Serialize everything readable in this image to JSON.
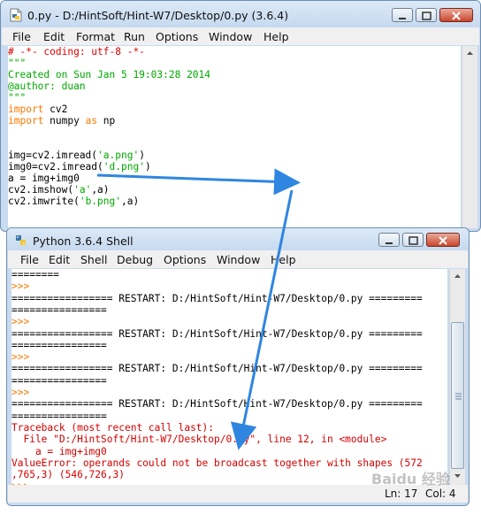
{
  "editor_window": {
    "title": "0.py - D:/HintSoft/Hint-W7/Desktop/0.py (3.6.4)",
    "menu": [
      "File",
      "Edit",
      "Format",
      "Run",
      "Options",
      "Window",
      "Help"
    ],
    "code_lines": [
      {
        "text": "# -*- coding: utf-8 -*-",
        "color": "red"
      },
      {
        "text": "\"\"\"",
        "color": "green"
      },
      {
        "text": "Created on Sun Jan 5 19:03:28 2014",
        "color": "green"
      },
      {
        "text": "@author: duan",
        "color": "green"
      },
      {
        "text": "\"\"\"",
        "color": "green"
      },
      {
        "text": "import",
        "color": "orange",
        "rest": " cv2"
      },
      {
        "text": "import",
        "color": "orange",
        "rest": " numpy ",
        "kw2": "as",
        "rest2": " np"
      },
      {
        "text": "",
        "color": "black"
      },
      {
        "text": "",
        "color": "black"
      },
      {
        "text": "img=cv2.imread(",
        "color": "black",
        "str": "'a.png'",
        "tail": ")"
      },
      {
        "text": "img0=cv2.imread(",
        "color": "black",
        "str": "'d.png'",
        "tail": ")"
      },
      {
        "text": "a = img+img0",
        "color": "black"
      },
      {
        "text": "cv2.imshow(",
        "color": "black",
        "str": "'a'",
        "tail": ",a)"
      },
      {
        "text": "cv2.imwrite(",
        "color": "black",
        "str": "'b.png'",
        "tail": ",a)"
      }
    ]
  },
  "shell_window": {
    "title": "Python 3.6.4 Shell",
    "menu": [
      "File",
      "Edit",
      "Shell",
      "Debug",
      "Options",
      "Window",
      "Help"
    ],
    "output_lines": [
      {
        "text": "========",
        "color": "black"
      },
      {
        "text": ">>>",
        "color": "orange"
      },
      {
        "text": "================= RESTART: D:/HintSoft/Hint-W7/Desktop/0.py =========",
        "color": "black"
      },
      {
        "text": "================",
        "color": "black"
      },
      {
        "text": ">>>",
        "color": "orange"
      },
      {
        "text": "================= RESTART: D:/HintSoft/Hint-W7/Desktop/0.py =========",
        "color": "black"
      },
      {
        "text": "================",
        "color": "black"
      },
      {
        "text": ">>>",
        "color": "orange"
      },
      {
        "text": "================= RESTART: D:/HintSoft/Hint-W7/Desktop/0.py =========",
        "color": "black"
      },
      {
        "text": "================",
        "color": "black"
      },
      {
        "text": ">>>",
        "color": "orange"
      },
      {
        "text": "================= RESTART: D:/HintSoft/Hint-W7/Desktop/0.py =========",
        "color": "black"
      },
      {
        "text": "================",
        "color": "black"
      },
      {
        "text": "Traceback (most recent call last):",
        "color": "err"
      },
      {
        "text": "  File \"D:/HintSoft/Hint-W7/Desktop/0.py\", line 12, in <module>",
        "color": "err"
      },
      {
        "text": "    a = img+img0",
        "color": "err"
      },
      {
        "text": "ValueError: operands could not be broadcast together with shapes (572",
        "color": "err"
      },
      {
        "text": ",765,3) (546,726,3)",
        "color": "err"
      },
      {
        "text": ">>> ",
        "color": "orange"
      }
    ],
    "status": {
      "line": "Ln: 17",
      "col": "Col: 4"
    }
  },
  "annotation": {
    "arrow_color": "#2f86e0"
  },
  "watermark": "Baidu 经验"
}
